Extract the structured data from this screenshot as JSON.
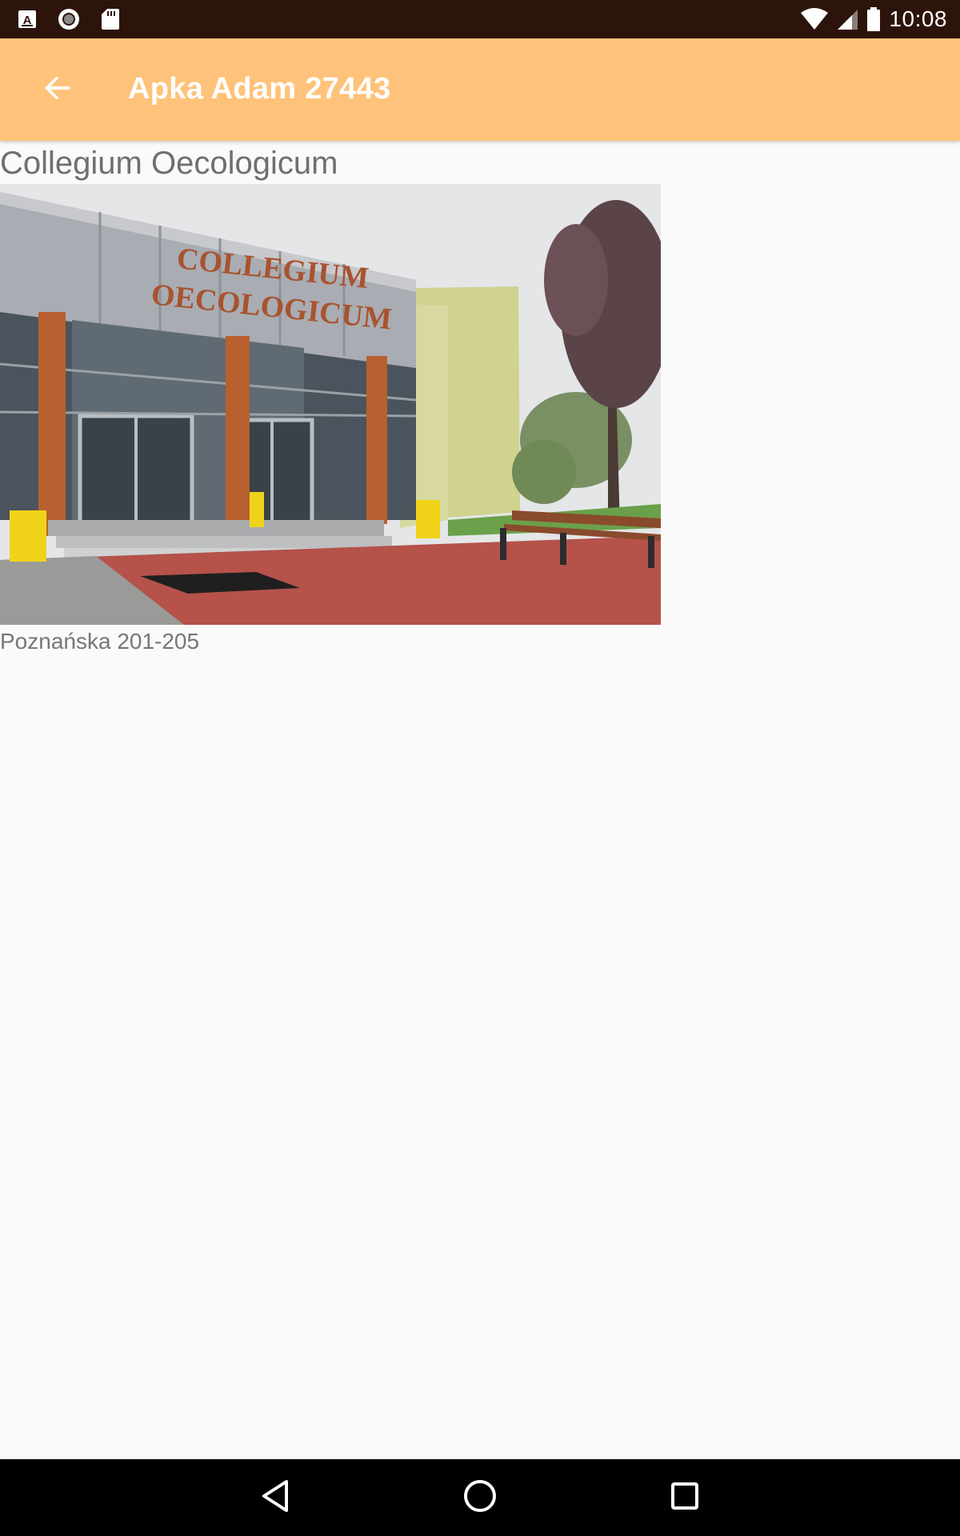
{
  "status_bar": {
    "time": "10:08",
    "icons_left": [
      "keyboard-icon",
      "record-icon",
      "sd-card-icon"
    ],
    "icons_right": [
      "wifi-icon",
      "signal-icon",
      "battery-icon"
    ]
  },
  "app_bar": {
    "title": "Apka Adam 27443",
    "back_icon": "arrow-back-icon",
    "color": "#ffc27a"
  },
  "place": {
    "name": "Collegium Oecologicum",
    "photo_sign_line1": "COLLEGIUM",
    "photo_sign_line2": "OECOLOGICUM",
    "address": "Poznańska 201-205"
  },
  "nav_bar": {
    "icons": [
      "back-triangle-icon",
      "home-circle-icon",
      "recents-square-icon"
    ]
  }
}
